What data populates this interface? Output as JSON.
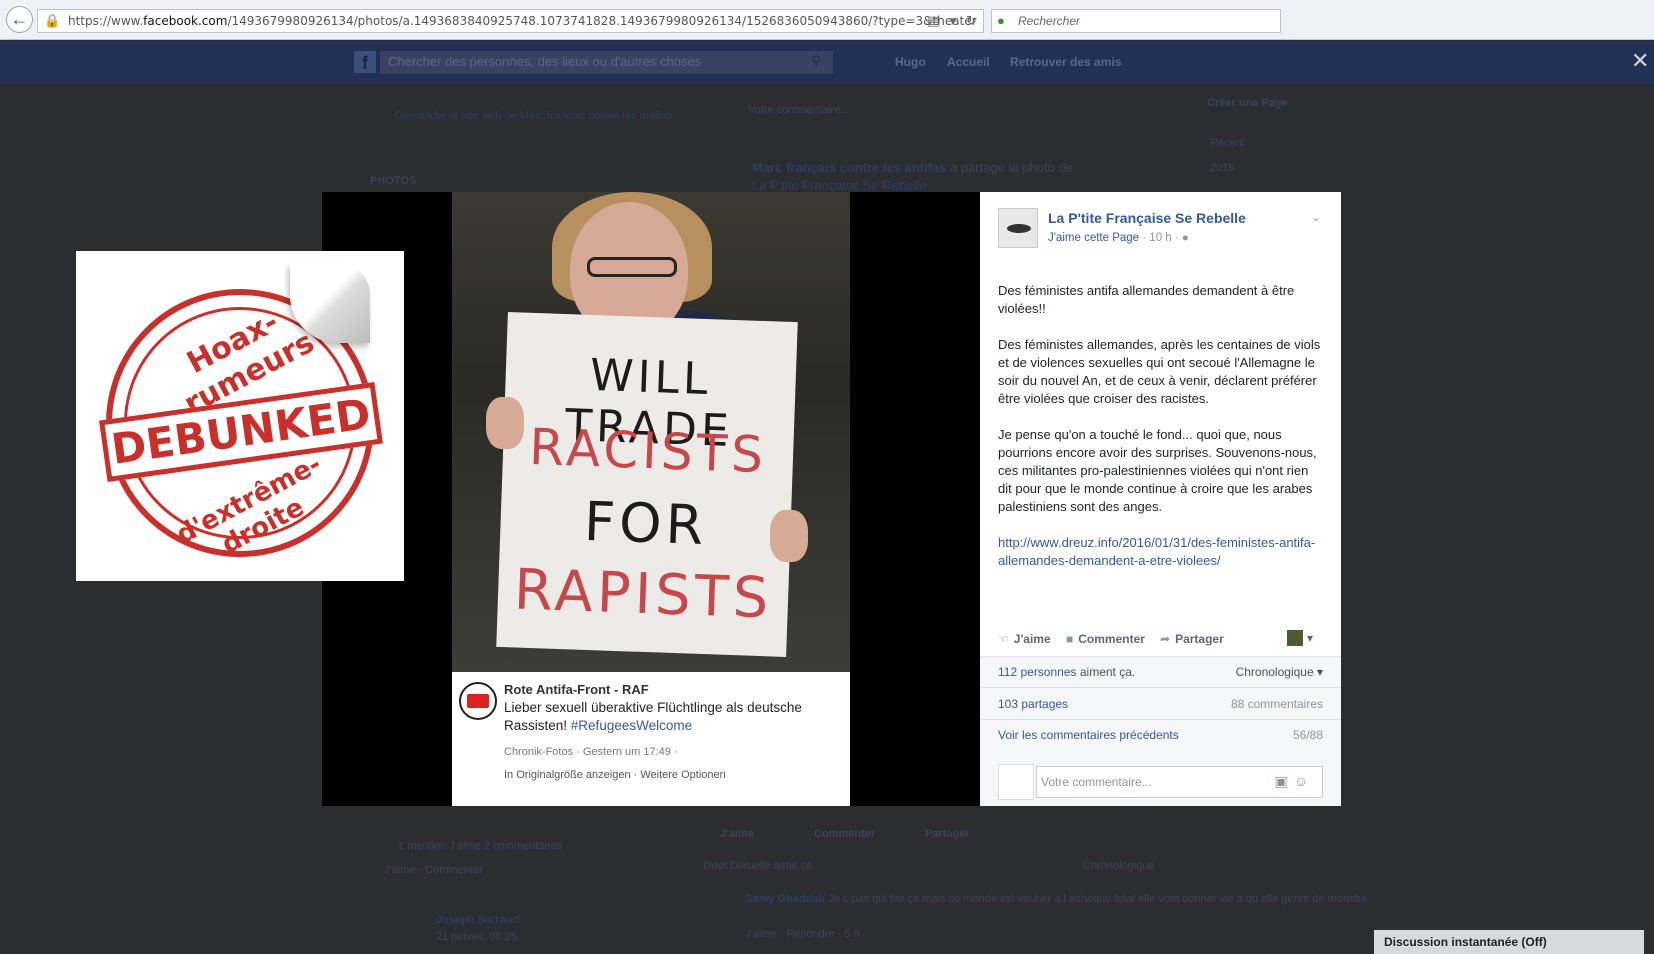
{
  "browser": {
    "url_prefix": "https://www.",
    "url_domain": "facebook.com",
    "url_rest": "/1493679980926134/photos/a.1493683840925748.1073741828.1493679980926134/1526836050943860/?type=3&theater",
    "search_placeholder": "Rechercher"
  },
  "fb_header": {
    "logo": "f",
    "search_placeholder": "Chercher des personnes, des lieux ou d'autres choses",
    "user": "Hugo",
    "home": "Accueil",
    "find_friends": "Retrouver des amis"
  },
  "background": {
    "request_link": "Demander le site web de Marc français contre les antifas",
    "photos_label": "PHOTOS",
    "comment_placeholder": "Votre commentaire...",
    "create_page": "Créer une Page",
    "recent": "Récent",
    "year_2016": "2016",
    "share_line_user": "Marc français contre les antifas",
    "share_line_text": "a partagé la photo de",
    "share_line_page": "La P'tite Française Se Rebelle",
    "likes_line": "1 mention J'aime   2 commentaires",
    "jaime_comment": "J'aime · Commenter",
    "jaime": "J'aime",
    "commenter": "Commenter",
    "partager": "Partager",
    "odet": "Odet Deruelle aime ça.",
    "chronologique": "Chronologique",
    "samy_name": "Samy Ghaddab",
    "samy_text": "Je c pas qui fait ça mais ce monde est vouher a l echeque total elle vont donner vie a qu elle genre de monstre",
    "samy_actions": "J'aime · Répondre · 5 h",
    "joseph_name": "Joseph Sarraud",
    "joseph_date": "21 janvier, 08:25",
    "chat": "Discussion instantanée (Off)"
  },
  "sticker": {
    "top_text": "Hoax-rumeurs",
    "center_text": "DEBUNKED",
    "bottom_text": "d'extrême-droite"
  },
  "photo": {
    "sign_line1": "WILL TRADE",
    "sign_line2": "RACISTS",
    "sign_line3": "FOR",
    "sign_line4": "RAPISTS",
    "caption_name": "Rote Antifa-Front - RAF",
    "caption_text": "Lieber sexuell überaktive Flüchtlinge als deutsche Rassisten!",
    "caption_tag": "#RefugeesWelcome",
    "caption_meta": "Chronik-Fotos · Gestern um 17:49 ·",
    "caption_links": "In Originalgröße anzeigen · Weitere Optionen"
  },
  "sidepanel": {
    "page_name": "La P'tite Française Se Rebelle",
    "like_page": "J'aime cette Page",
    "time": "10 h",
    "post_p1": "Des féministes antifa allemandes demandent à être violées!!",
    "post_p2": "Des féministes allemandes, après les centaines de viols et de violences sexuelles qui ont secoué l'Allemagne le soir du nouvel An, et de ceux à venir, déclarent préférer être violées que croiser des racistes.",
    "post_p3": "Je pense qu'on a touché le fond... quoi que, nous pourrions encore avoir des surprises. Souvenons-nous, ces militantes pro-palestiniennes violées qui n'ont rien dit pour que le monde continue à croire que les arabes palestiniens sont des anges.",
    "post_link": "http://www.dreuz.info/2016/01/31/des-feministes-antifa-allemandes-demandent-a-etre-violees/",
    "action_like": "J'aime",
    "action_comment": "Commenter",
    "action_share": "Partager",
    "likes_count": "112 personnes",
    "likes_suffix": "aiment ça.",
    "order": "Chronologique",
    "shares": "103 partages",
    "comments": "88 commentaires",
    "prev_comments": "Voir les commentaires précédents",
    "comment_progress": "56/88",
    "comment_placeholder": "Votre commentaire..."
  }
}
